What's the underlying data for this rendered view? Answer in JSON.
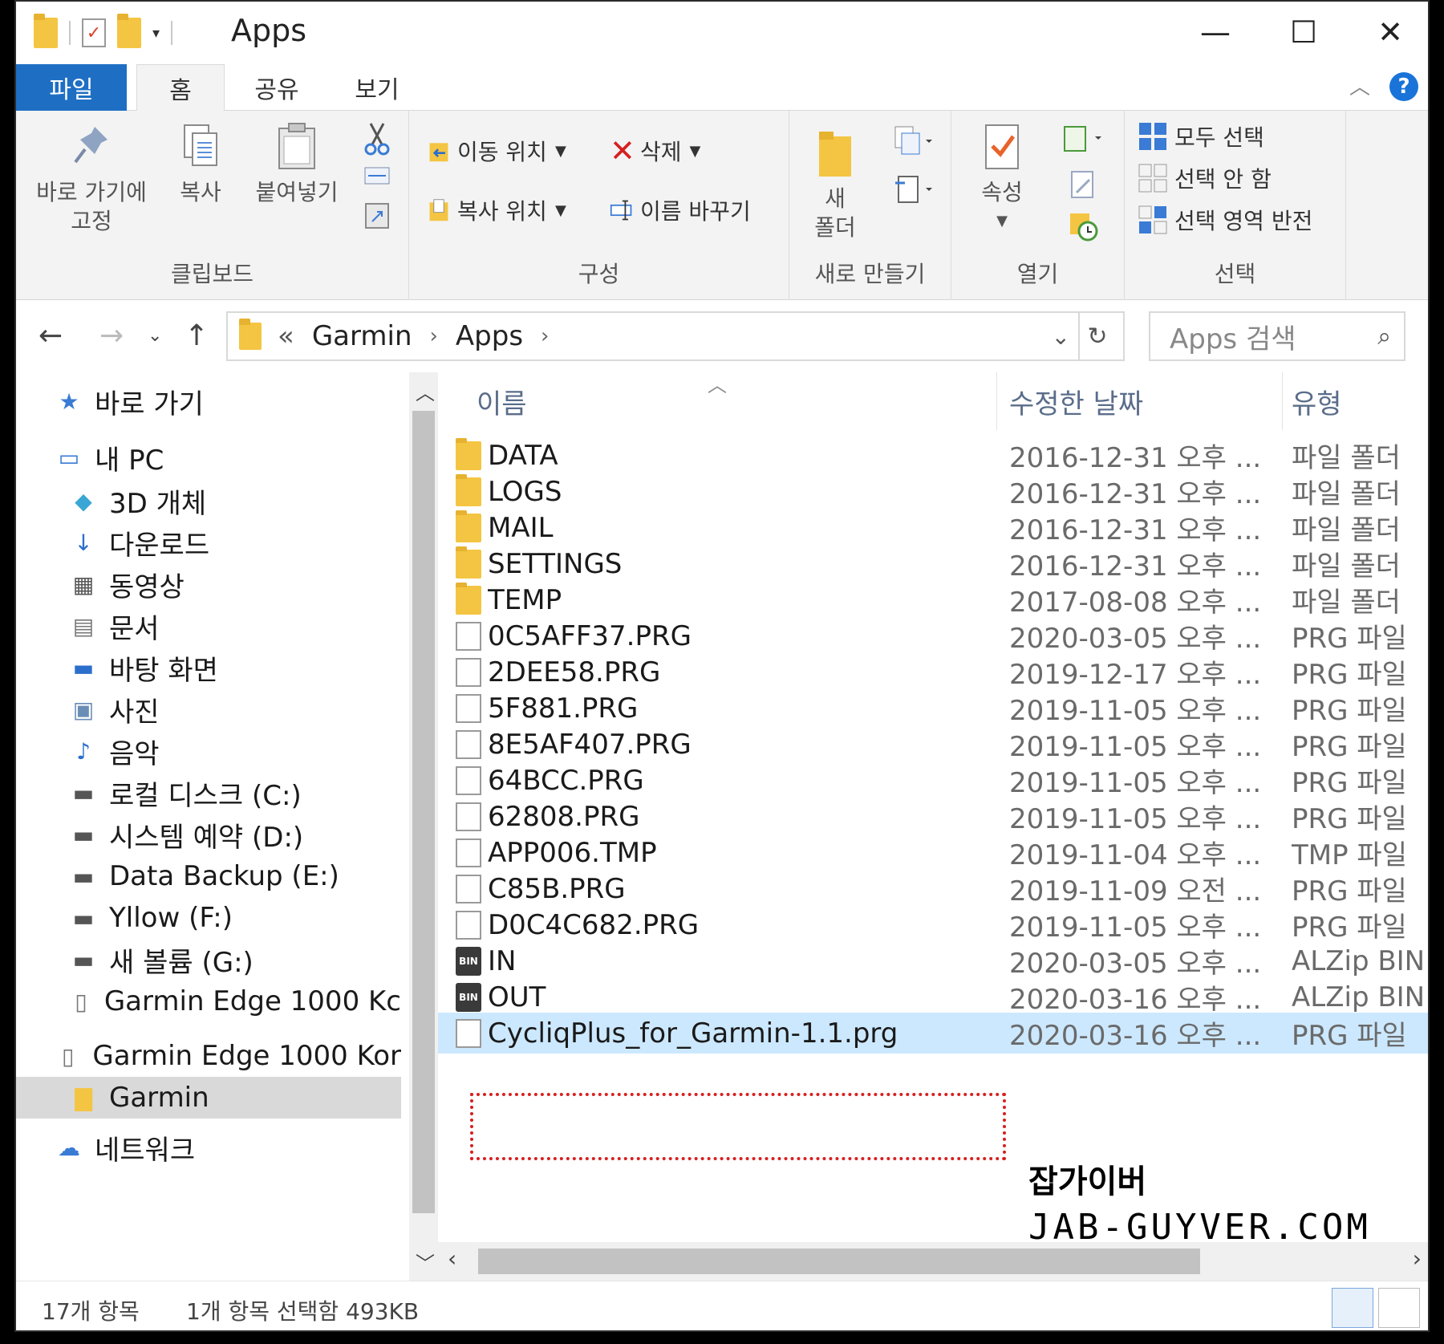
{
  "window": {
    "title": "Apps",
    "controls": {
      "minimize": "—",
      "maximize": "☐",
      "close": "✕"
    }
  },
  "tabs": [
    {
      "label": "파일"
    },
    {
      "label": "홈"
    },
    {
      "label": "공유"
    },
    {
      "label": "보기"
    }
  ],
  "ribbon": {
    "clipboard": {
      "pin_label": "바로 가기에\n고정",
      "copy_label": "복사",
      "paste_label": "붙여넣기",
      "group_label": "클립보드"
    },
    "organize": {
      "move_to": "이동 위치",
      "copy_to": "복사 위치",
      "delete": "삭제",
      "rename": "이름 바꾸기",
      "group_label": "구성"
    },
    "new": {
      "new_folder": "새\n폴더",
      "group_label": "새로 만들기"
    },
    "open": {
      "properties": "속성",
      "group_label": "열기"
    },
    "select": {
      "select_all": "모두 선택",
      "select_none": "선택 안 함",
      "invert": "선택 영역 반전",
      "group_label": "선택"
    }
  },
  "address": {
    "overflow": "«",
    "crumbs": [
      "Garmin",
      "Apps"
    ],
    "search_placeholder": "Apps 검색"
  },
  "nav": {
    "items": [
      {
        "label": "바로 가기",
        "icon": "star-icon"
      },
      {
        "label": "내 PC",
        "icon": "pc-icon"
      },
      {
        "label": "3D 개체",
        "icon": "cube-icon"
      },
      {
        "label": "다운로드",
        "icon": "download-icon"
      },
      {
        "label": "동영상",
        "icon": "video-icon"
      },
      {
        "label": "문서",
        "icon": "document-icon"
      },
      {
        "label": "바탕 화면",
        "icon": "desktop-icon"
      },
      {
        "label": "사진",
        "icon": "picture-icon"
      },
      {
        "label": "음악",
        "icon": "music-icon"
      },
      {
        "label": "로컬 디스크 (C:)",
        "icon": "drive-icon"
      },
      {
        "label": "시스템 예약 (D:)",
        "icon": "drive-icon"
      },
      {
        "label": "Data Backup (E:)",
        "icon": "drive-icon"
      },
      {
        "label": "Yllow (F:)",
        "icon": "drive-icon"
      },
      {
        "label": "새 볼륨 (G:)",
        "icon": "drive-icon"
      },
      {
        "label": "Garmin Edge 1000 Kc",
        "icon": "device-icon"
      },
      {
        "label": "Garmin Edge 1000 Kor",
        "icon": "device-icon"
      },
      {
        "label": "Garmin",
        "icon": "folder-icon"
      },
      {
        "label": "네트워크",
        "icon": "network-icon"
      }
    ]
  },
  "columns": {
    "name": "이름",
    "date": "수정한 날짜",
    "type": "유형"
  },
  "files": [
    {
      "name": "DATA",
      "date": "2016-12-31 오후 ...",
      "type": "파일 폴더",
      "kind": "folder"
    },
    {
      "name": "LOGS",
      "date": "2016-12-31 오후 ...",
      "type": "파일 폴더",
      "kind": "folder"
    },
    {
      "name": "MAIL",
      "date": "2016-12-31 오후 ...",
      "type": "파일 폴더",
      "kind": "folder"
    },
    {
      "name": "SETTINGS",
      "date": "2016-12-31 오후 ...",
      "type": "파일 폴더",
      "kind": "folder"
    },
    {
      "name": "TEMP",
      "date": "2017-08-08 오후 ...",
      "type": "파일 폴더",
      "kind": "folder"
    },
    {
      "name": "0C5AFF37.PRG",
      "date": "2020-03-05 오후 ...",
      "type": "PRG 파일",
      "kind": "file"
    },
    {
      "name": "2DEE58.PRG",
      "date": "2019-12-17 오후 ...",
      "type": "PRG 파일",
      "kind": "file"
    },
    {
      "name": "5F881.PRG",
      "date": "2019-11-05 오후 ...",
      "type": "PRG 파일",
      "kind": "file"
    },
    {
      "name": "8E5AF407.PRG",
      "date": "2019-11-05 오후 ...",
      "type": "PRG 파일",
      "kind": "file"
    },
    {
      "name": "64BCC.PRG",
      "date": "2019-11-05 오후 ...",
      "type": "PRG 파일",
      "kind": "file"
    },
    {
      "name": "62808.PRG",
      "date": "2019-11-05 오후 ...",
      "type": "PRG 파일",
      "kind": "file"
    },
    {
      "name": "APP006.TMP",
      "date": "2019-11-04 오후 ...",
      "type": "TMP 파일",
      "kind": "file"
    },
    {
      "name": "C85B.PRG",
      "date": "2019-11-09 오전 ...",
      "type": "PRG 파일",
      "kind": "file"
    },
    {
      "name": "D0C4C682.PRG",
      "date": "2019-11-05 오후 ...",
      "type": "PRG 파일",
      "kind": "file"
    },
    {
      "name": "IN",
      "date": "2020-03-05 오후 ...",
      "type": "ALZip BIN F",
      "kind": "bin"
    },
    {
      "name": "OUT",
      "date": "2020-03-16 오후 ...",
      "type": "ALZip BIN F",
      "kind": "bin"
    },
    {
      "name": "CycliqPlus_for_Garmin-1.1.prg",
      "date": "2020-03-16 오후 ...",
      "type": "PRG 파일",
      "kind": "file",
      "selected": true
    }
  ],
  "status": {
    "count": "17개 항목",
    "selection": "1개 항목 선택함 493KB"
  },
  "watermark": {
    "line1": "잡가이버",
    "line2": "JAB-GUYVER.COM"
  },
  "colors": {
    "accent": "#1e6fc4",
    "selection": "#cce8ff",
    "highlight_box": "#d62020",
    "folder": "#f4c542"
  }
}
